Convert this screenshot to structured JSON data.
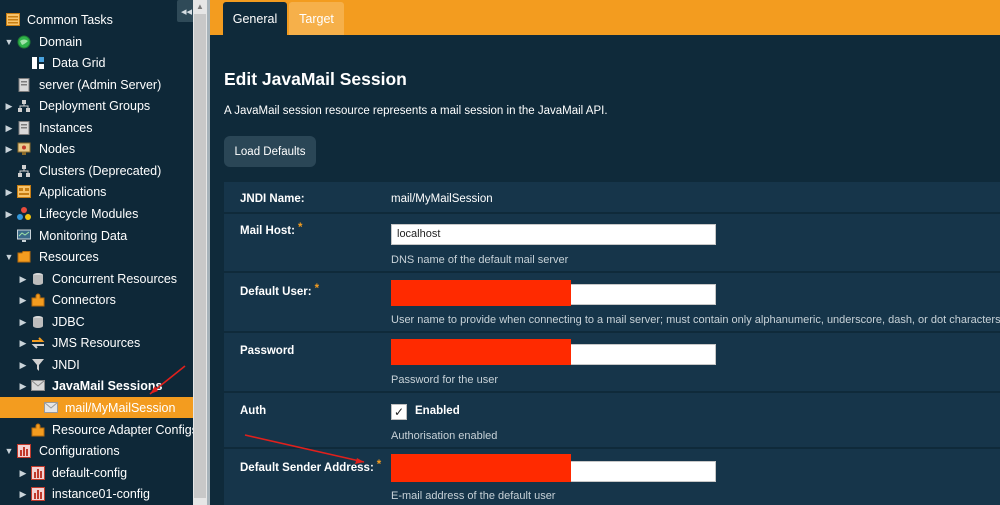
{
  "sidebar": {
    "collapse_label": "◂◂",
    "items": [
      {
        "label": "Common Tasks"
      },
      {
        "label": "Domain"
      },
      {
        "label": "Data Grid"
      },
      {
        "label": "server (Admin Server)"
      },
      {
        "label": "Deployment Groups"
      },
      {
        "label": "Instances"
      },
      {
        "label": "Nodes"
      },
      {
        "label": "Clusters (Deprecated)"
      },
      {
        "label": "Applications"
      },
      {
        "label": "Lifecycle Modules"
      },
      {
        "label": "Monitoring Data"
      },
      {
        "label": "Resources"
      },
      {
        "label": "Concurrent Resources"
      },
      {
        "label": "Connectors"
      },
      {
        "label": "JDBC"
      },
      {
        "label": "JMS Resources"
      },
      {
        "label": "JNDI"
      },
      {
        "label": "JavaMail Sessions"
      },
      {
        "label": "mail/MyMailSession"
      },
      {
        "label": "Resource Adapter Configs"
      },
      {
        "label": "Configurations"
      },
      {
        "label": "default-config"
      },
      {
        "label": "instance01-config"
      }
    ]
  },
  "tabs": {
    "general": "General",
    "target": "Target"
  },
  "page": {
    "title": "Edit JavaMail Session",
    "description": "A JavaMail session resource represents a mail session in the JavaMail API.",
    "load_defaults": "Load Defaults"
  },
  "form": {
    "required_mark": "*",
    "jndi": {
      "label": "JNDI Name:",
      "value": "mail/MyMailSession"
    },
    "mail_host": {
      "label": "Mail Host:",
      "value": "localhost",
      "help": "DNS name of the default mail server"
    },
    "default_user": {
      "label": "Default User:",
      "help": "User name to provide when connecting to a mail server; must contain only alphanumeric, underscore, dash, or dot characters"
    },
    "password": {
      "label": "Password",
      "help": "Password for the user"
    },
    "auth": {
      "label": "Auth",
      "check_mark": "✓",
      "check_label": "Enabled",
      "help": "Authorisation enabled"
    },
    "sender": {
      "label": "Default Sender Address:",
      "help": "E-mail address of the default user"
    }
  },
  "colors": {
    "accent": "#f39c1f",
    "background": "#0f2a3a",
    "redaction": "#ff2a00",
    "annotation": "#e0201c"
  }
}
